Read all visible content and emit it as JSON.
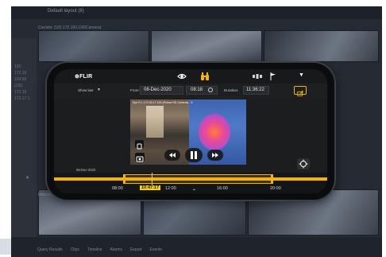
{
  "background": {
    "window_title": "Default layout (8)",
    "camera_label": "Corridor (192.172.160.10/0Camera)",
    "side_numbers": [
      "192.",
      "172.16",
      "104.50",
      "(192.",
      "172.16",
      "172.17.1"
    ],
    "x_label": "✕",
    "intersect_label": "Intersect",
    "bottom_tabs": [
      "Query Results",
      "Clips",
      "Timeline",
      "Alarms",
      "Export",
      "Events"
    ]
  },
  "app": {
    "logo": "⊕FLIR",
    "menu_chevron": "▼"
  },
  "controls": {
    "show_last_label": "Show last",
    "show_last_caret": "▼",
    "from_label": "From:",
    "date_value": "08-Dec-2020",
    "time_value": "08:18",
    "duration_label": "Duration:",
    "duration_value": "11:36:22"
  },
  "video": {
    "label": "Eye R L 172.30.17.100 (Pulsar HD Camera) - 5"
  },
  "left_date": "08-Dec-2020",
  "timeline": {
    "ticks": [
      "08:00",
      "12:00",
      "16:00",
      "20:00"
    ],
    "playhead_time": "10:47:17",
    "up_chevron": "⌃"
  },
  "colors": {
    "accent": "#f5b400",
    "background": "#1c1d1f"
  }
}
